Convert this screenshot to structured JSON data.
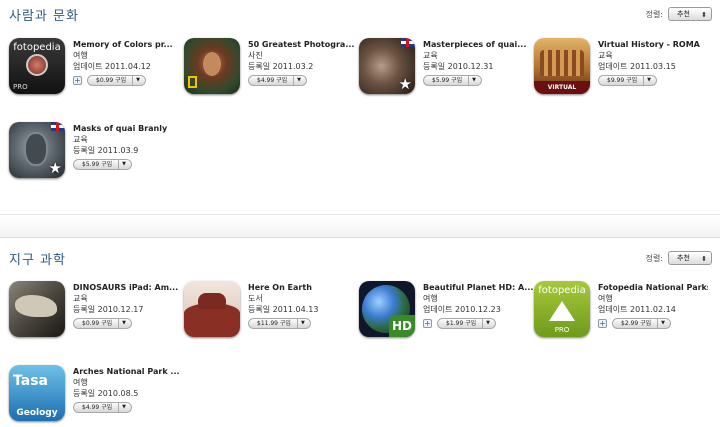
{
  "sections": [
    {
      "title": "사람과 문화",
      "sort_label": "정렬:",
      "sort_value": "추천",
      "apps": [
        {
          "name": "Memory of Colors pr...",
          "category": "여행",
          "date": "업데이트 2011.04.12",
          "price": "$0.99 구입"
        },
        {
          "name": "50 Greatest Photogra...",
          "category": "사진",
          "date": "등록일 2011.03.2",
          "price": "$4.99 구입"
        },
        {
          "name": "Masterpieces of quai...",
          "category": "교육",
          "date": "등록일 2010.12.31",
          "price": "$5.99 구입"
        },
        {
          "name": "Virtual History - ROMA",
          "category": "교육",
          "date": "업데이트 2011.03.15",
          "price": "$9.99 구입",
          "icon_text": "VIRTUAL HISTORY"
        },
        {
          "name": "Masks of quai Branly",
          "category": "교육",
          "date": "등록일 2011.03.9",
          "price": "$5.99 구입"
        }
      ]
    },
    {
      "title": "지구 과학",
      "sort_label": "정렬:",
      "sort_value": "추천",
      "apps": [
        {
          "name": "DINOSAURS iPad: Am...",
          "category": "교육",
          "date": "등록일 2010.12.17",
          "price": "$0.99 구입"
        },
        {
          "name": "Here On Earth",
          "category": "도서",
          "date": "등록일 2011.04.13",
          "price": "$11.99 구입"
        },
        {
          "name": "Beautiful Planet HD: A...",
          "category": "여행",
          "date": "업데이트 2010.12.23",
          "price": "$1.99 구입",
          "icon_text": "HD"
        },
        {
          "name": "Fotopedia National Parks",
          "category": "여행",
          "date": "업데이트 2011.02.14",
          "price": "$2.99 구입",
          "icon_text": "fotopedia",
          "icon_sub": "PRO"
        },
        {
          "name": "Arches National Park ...",
          "category": "여행",
          "date": "등록일 2010.08.5",
          "price": "$4.99 구입",
          "icon_text": "Tasa",
          "icon_sub": "Geology"
        }
      ]
    }
  ],
  "fotopedia_icon": {
    "text": "fotopedia",
    "sub": "PRO"
  },
  "sort_arrow": "⬍",
  "buy_arrow": "▼",
  "plus": "+"
}
